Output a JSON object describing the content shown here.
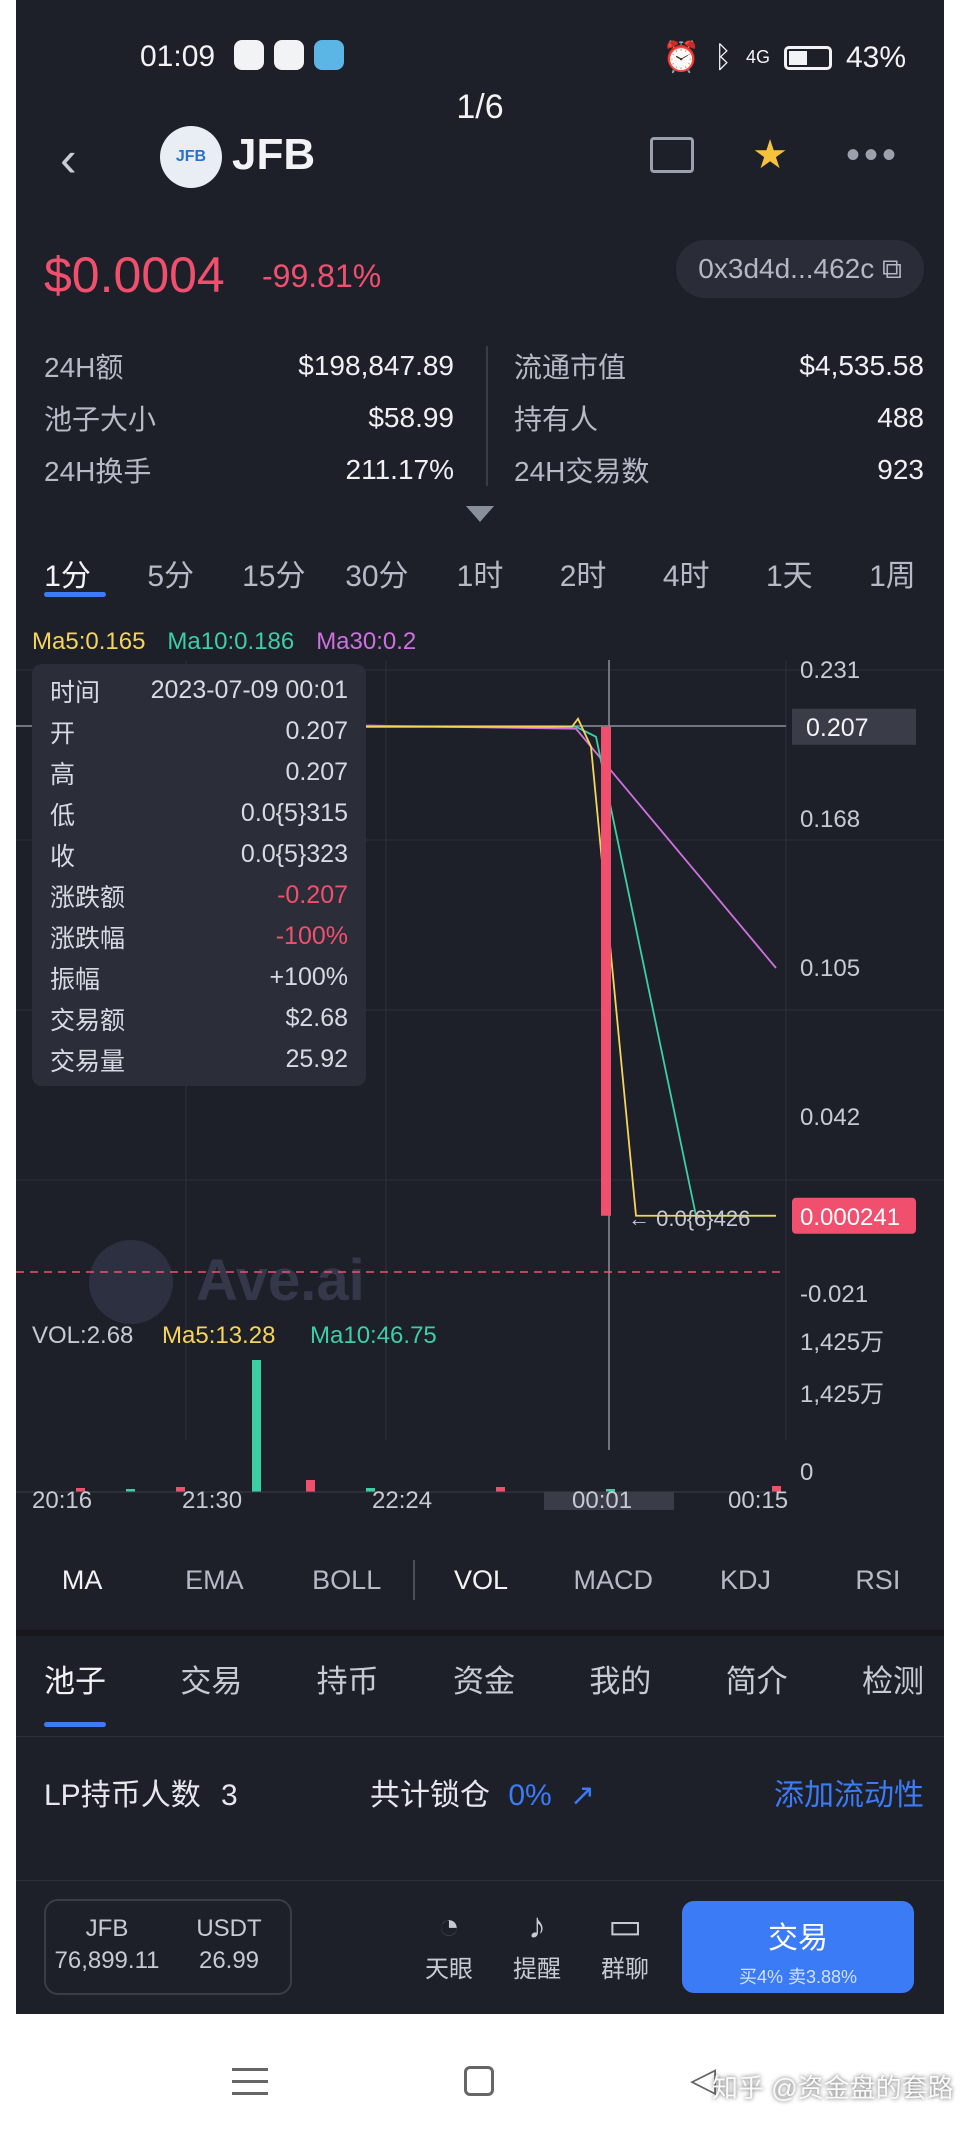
{
  "status": {
    "time": "01:09",
    "battery": "43%",
    "signal": "4G"
  },
  "pager": "1/6",
  "header": {
    "coin": "JFB",
    "logo_text": "JFB"
  },
  "price": {
    "value": "$0.0004",
    "change": "-99.81%",
    "address": "0x3d4d...462c"
  },
  "stats": {
    "left": [
      {
        "k": "24H额",
        "v": "$198,847.89"
      },
      {
        "k": "池子大小",
        "v": "$58.99"
      },
      {
        "k": "24H换手",
        "v": "211.17%"
      }
    ],
    "right": [
      {
        "k": "流通市值",
        "v": "$4,535.58"
      },
      {
        "k": "持有人",
        "v": "488"
      },
      {
        "k": "24H交易数",
        "v": "923"
      }
    ]
  },
  "timeframes": [
    "1分",
    "5分",
    "15分",
    "30分",
    "1时",
    "2时",
    "4时",
    "1天",
    "1周"
  ],
  "ma_legend": {
    "ma5": "Ma5:0.165",
    "ma10": "Ma10:0.186",
    "ma30": "Ma30:0.2"
  },
  "colors": {
    "ma5": "#f6d45a",
    "ma10": "#3ccfa3",
    "ma30": "#d070e0",
    "up": "#f0506e",
    "accent": "#3b7bf6"
  },
  "tooltip": [
    {
      "k": "时间",
      "v": "2023-07-09 00:01"
    },
    {
      "k": "开",
      "v": "0.207"
    },
    {
      "k": "高",
      "v": "0.207"
    },
    {
      "k": "低",
      "v": "0.0{5}315"
    },
    {
      "k": "收",
      "v": "0.0{5}323"
    },
    {
      "k": "涨跌额",
      "v": "-0.207",
      "red": true
    },
    {
      "k": "涨跌幅",
      "v": "-100%",
      "red": true
    },
    {
      "k": "振幅",
      "v": "+100%"
    },
    {
      "k": "交易额",
      "v": "$2.68"
    },
    {
      "k": "交易量",
      "v": "25.92"
    }
  ],
  "chart_data": {
    "type": "candlestick",
    "y_ticks": [
      "0.231",
      "0.168",
      "0.105",
      "0.042",
      "-0.021"
    ],
    "current_price_label": "0.207",
    "last_price_label": "0.000241",
    "low_annotation": "0.0{6}426",
    "x_ticks": [
      "20:16",
      "21:30",
      "22:24",
      "00:01",
      "00:15"
    ],
    "watermark": "Ave.ai",
    "flat_level": 0.207,
    "drop_to": 0.000241,
    "ma30_end": 0.105,
    "volume": {
      "legend_vol": "VOL:2.68",
      "legend_ma5": "Ma5:13.28",
      "legend_ma10": "Ma10:46.75",
      "y_ticks": [
        "1,425万",
        "1,425万",
        "0"
      ]
    }
  },
  "indicators": [
    "MA",
    "EMA",
    "BOLL",
    "VOL",
    "MACD",
    "KDJ",
    "RSI"
  ],
  "bottom_tabs": [
    "池子",
    "交易",
    "持币",
    "资金",
    "我的",
    "简介",
    "检测"
  ],
  "lp": {
    "holders_label": "LP持币人数",
    "holders": "3",
    "lock_label": "共计锁仓",
    "lock_pct": "0%",
    "add_liquidity": "添加流动性"
  },
  "footer": {
    "wallet": [
      {
        "sym": "JFB",
        "amt": "76,899.11"
      },
      {
        "sym": "USDT",
        "amt": "26.99"
      }
    ],
    "actions": [
      {
        "icon": "gauge-icon",
        "label": "天眼"
      },
      {
        "icon": "bell-icon",
        "label": "提醒"
      },
      {
        "icon": "chat-icon",
        "label": "群聊"
      }
    ],
    "trade": "交易",
    "fees": "买4% 卖3.88%"
  },
  "watermark_text": "知乎 @资金盘的套路"
}
